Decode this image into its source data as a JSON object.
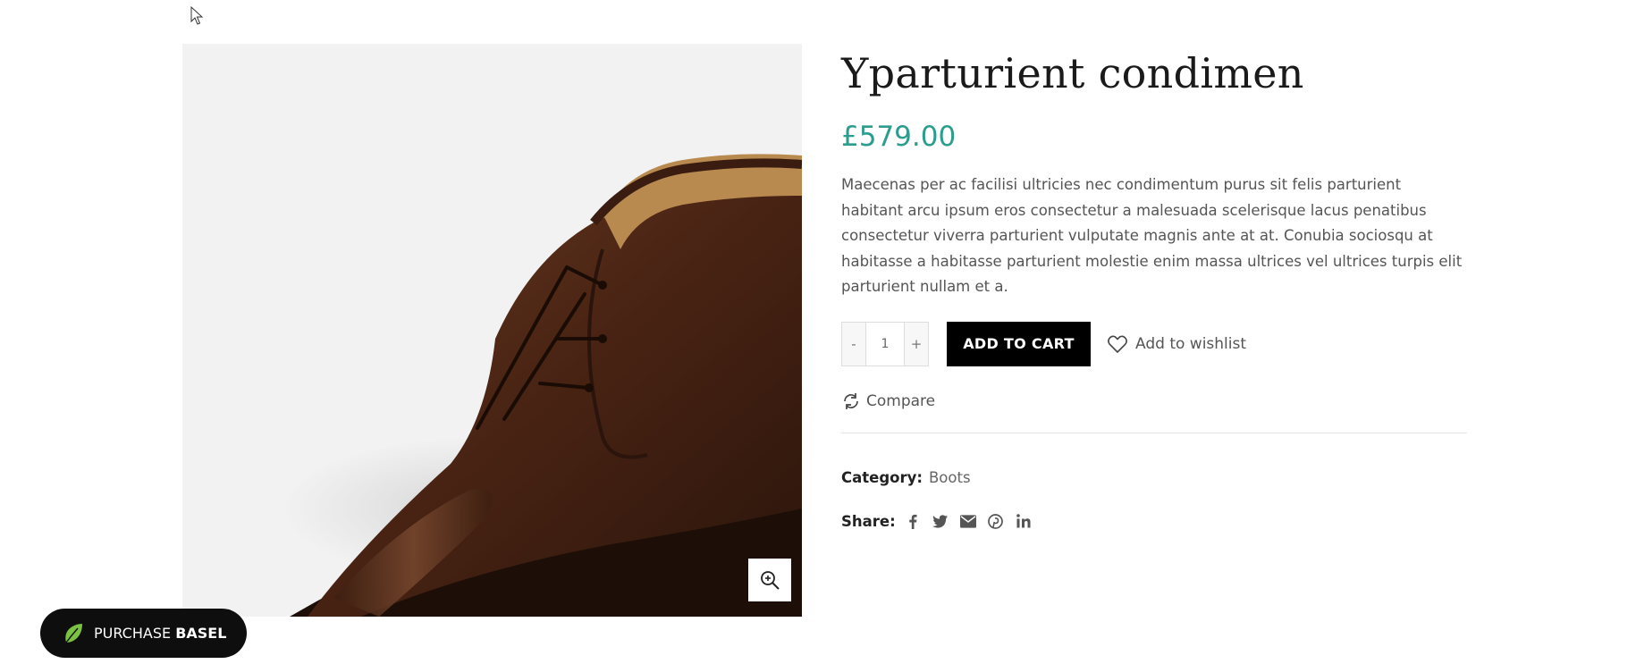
{
  "product": {
    "title": "Yparturient condimen",
    "price": "£579.00",
    "description": "Maecenas per ac facilisi ultricies nec condimentum purus sit felis parturient habitant arcu ipsum eros consectetur a malesuada scelerisque lacus penatibus consectetur viverra parturient vulputate magnis ante at at. Conubia sociosqu at habitasse a habitasse parturient molestie enim massa ultrices vel ultrices turpis elit parturient nullam et a.",
    "image_icon": "brown-leather-chukka-boot"
  },
  "cart": {
    "qty_minus": "-",
    "qty_value": "1",
    "qty_plus": "+",
    "add_to_cart": "ADD TO CART",
    "wishlist": "Add to wishlist",
    "compare": "Compare"
  },
  "meta": {
    "category_label": "Category:",
    "category_value": "Boots",
    "share_label": "Share:",
    "share_icons": [
      "facebook-icon",
      "twitter-icon",
      "email-icon",
      "pinterest-icon",
      "linkedin-icon"
    ]
  },
  "badge": {
    "text_light": "PURCHASE",
    "text_bold": "BASEL"
  },
  "colors": {
    "price": "#2a9d8f",
    "button": "#000000",
    "badge_bg": "#0e0e0e",
    "leaf": "#7cc242"
  }
}
